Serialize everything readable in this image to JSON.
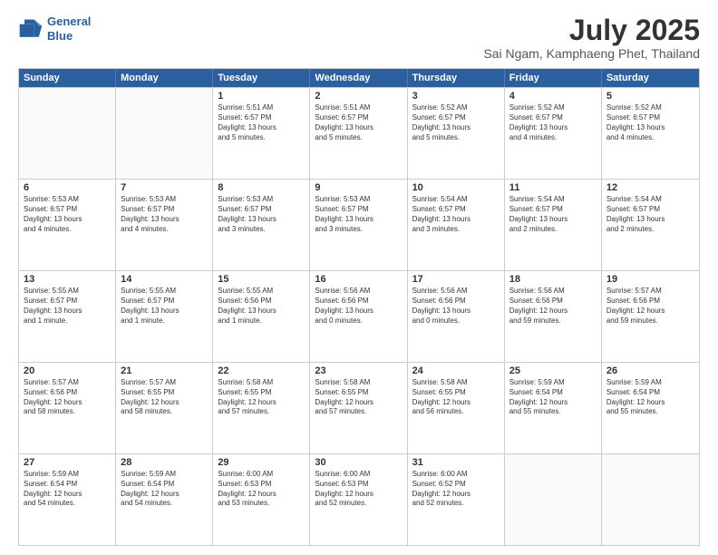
{
  "logo": {
    "line1": "General",
    "line2": "Blue"
  },
  "title": "July 2025",
  "subtitle": "Sai Ngam, Kamphaeng Phet, Thailand",
  "header_days": [
    "Sunday",
    "Monday",
    "Tuesday",
    "Wednesday",
    "Thursday",
    "Friday",
    "Saturday"
  ],
  "weeks": [
    [
      {
        "day": "",
        "empty": true,
        "lines": []
      },
      {
        "day": "",
        "empty": true,
        "lines": []
      },
      {
        "day": "1",
        "empty": false,
        "lines": [
          "Sunrise: 5:51 AM",
          "Sunset: 6:57 PM",
          "Daylight: 13 hours",
          "and 5 minutes."
        ]
      },
      {
        "day": "2",
        "empty": false,
        "lines": [
          "Sunrise: 5:51 AM",
          "Sunset: 6:57 PM",
          "Daylight: 13 hours",
          "and 5 minutes."
        ]
      },
      {
        "day": "3",
        "empty": false,
        "lines": [
          "Sunrise: 5:52 AM",
          "Sunset: 6:57 PM",
          "Daylight: 13 hours",
          "and 5 minutes."
        ]
      },
      {
        "day": "4",
        "empty": false,
        "lines": [
          "Sunrise: 5:52 AM",
          "Sunset: 6:57 PM",
          "Daylight: 13 hours",
          "and 4 minutes."
        ]
      },
      {
        "day": "5",
        "empty": false,
        "lines": [
          "Sunrise: 5:52 AM",
          "Sunset: 6:57 PM",
          "Daylight: 13 hours",
          "and 4 minutes."
        ]
      }
    ],
    [
      {
        "day": "6",
        "empty": false,
        "lines": [
          "Sunrise: 5:53 AM",
          "Sunset: 6:57 PM",
          "Daylight: 13 hours",
          "and 4 minutes."
        ]
      },
      {
        "day": "7",
        "empty": false,
        "lines": [
          "Sunrise: 5:53 AM",
          "Sunset: 6:57 PM",
          "Daylight: 13 hours",
          "and 4 minutes."
        ]
      },
      {
        "day": "8",
        "empty": false,
        "lines": [
          "Sunrise: 5:53 AM",
          "Sunset: 6:57 PM",
          "Daylight: 13 hours",
          "and 3 minutes."
        ]
      },
      {
        "day": "9",
        "empty": false,
        "lines": [
          "Sunrise: 5:53 AM",
          "Sunset: 6:57 PM",
          "Daylight: 13 hours",
          "and 3 minutes."
        ]
      },
      {
        "day": "10",
        "empty": false,
        "lines": [
          "Sunrise: 5:54 AM",
          "Sunset: 6:57 PM",
          "Daylight: 13 hours",
          "and 3 minutes."
        ]
      },
      {
        "day": "11",
        "empty": false,
        "lines": [
          "Sunrise: 5:54 AM",
          "Sunset: 6:57 PM",
          "Daylight: 13 hours",
          "and 2 minutes."
        ]
      },
      {
        "day": "12",
        "empty": false,
        "lines": [
          "Sunrise: 5:54 AM",
          "Sunset: 6:57 PM",
          "Daylight: 13 hours",
          "and 2 minutes."
        ]
      }
    ],
    [
      {
        "day": "13",
        "empty": false,
        "lines": [
          "Sunrise: 5:55 AM",
          "Sunset: 6:57 PM",
          "Daylight: 13 hours",
          "and 1 minute."
        ]
      },
      {
        "day": "14",
        "empty": false,
        "lines": [
          "Sunrise: 5:55 AM",
          "Sunset: 6:57 PM",
          "Daylight: 13 hours",
          "and 1 minute."
        ]
      },
      {
        "day": "15",
        "empty": false,
        "lines": [
          "Sunrise: 5:55 AM",
          "Sunset: 6:56 PM",
          "Daylight: 13 hours",
          "and 1 minute."
        ]
      },
      {
        "day": "16",
        "empty": false,
        "lines": [
          "Sunrise: 5:56 AM",
          "Sunset: 6:56 PM",
          "Daylight: 13 hours",
          "and 0 minutes."
        ]
      },
      {
        "day": "17",
        "empty": false,
        "lines": [
          "Sunrise: 5:56 AM",
          "Sunset: 6:56 PM",
          "Daylight: 13 hours",
          "and 0 minutes."
        ]
      },
      {
        "day": "18",
        "empty": false,
        "lines": [
          "Sunrise: 5:56 AM",
          "Sunset: 6:56 PM",
          "Daylight: 12 hours",
          "and 59 minutes."
        ]
      },
      {
        "day": "19",
        "empty": false,
        "lines": [
          "Sunrise: 5:57 AM",
          "Sunset: 6:56 PM",
          "Daylight: 12 hours",
          "and 59 minutes."
        ]
      }
    ],
    [
      {
        "day": "20",
        "empty": false,
        "lines": [
          "Sunrise: 5:57 AM",
          "Sunset: 6:56 PM",
          "Daylight: 12 hours",
          "and 58 minutes."
        ]
      },
      {
        "day": "21",
        "empty": false,
        "lines": [
          "Sunrise: 5:57 AM",
          "Sunset: 6:55 PM",
          "Daylight: 12 hours",
          "and 58 minutes."
        ]
      },
      {
        "day": "22",
        "empty": false,
        "lines": [
          "Sunrise: 5:58 AM",
          "Sunset: 6:55 PM",
          "Daylight: 12 hours",
          "and 57 minutes."
        ]
      },
      {
        "day": "23",
        "empty": false,
        "lines": [
          "Sunrise: 5:58 AM",
          "Sunset: 6:55 PM",
          "Daylight: 12 hours",
          "and 57 minutes."
        ]
      },
      {
        "day": "24",
        "empty": false,
        "lines": [
          "Sunrise: 5:58 AM",
          "Sunset: 6:55 PM",
          "Daylight: 12 hours",
          "and 56 minutes."
        ]
      },
      {
        "day": "25",
        "empty": false,
        "lines": [
          "Sunrise: 5:59 AM",
          "Sunset: 6:54 PM",
          "Daylight: 12 hours",
          "and 55 minutes."
        ]
      },
      {
        "day": "26",
        "empty": false,
        "lines": [
          "Sunrise: 5:59 AM",
          "Sunset: 6:54 PM",
          "Daylight: 12 hours",
          "and 55 minutes."
        ]
      }
    ],
    [
      {
        "day": "27",
        "empty": false,
        "lines": [
          "Sunrise: 5:59 AM",
          "Sunset: 6:54 PM",
          "Daylight: 12 hours",
          "and 54 minutes."
        ]
      },
      {
        "day": "28",
        "empty": false,
        "lines": [
          "Sunrise: 5:59 AM",
          "Sunset: 6:54 PM",
          "Daylight: 12 hours",
          "and 54 minutes."
        ]
      },
      {
        "day": "29",
        "empty": false,
        "lines": [
          "Sunrise: 6:00 AM",
          "Sunset: 6:53 PM",
          "Daylight: 12 hours",
          "and 53 minutes."
        ]
      },
      {
        "day": "30",
        "empty": false,
        "lines": [
          "Sunrise: 6:00 AM",
          "Sunset: 6:53 PM",
          "Daylight: 12 hours",
          "and 52 minutes."
        ]
      },
      {
        "day": "31",
        "empty": false,
        "lines": [
          "Sunrise: 6:00 AM",
          "Sunset: 6:52 PM",
          "Daylight: 12 hours",
          "and 52 minutes."
        ]
      },
      {
        "day": "",
        "empty": true,
        "lines": []
      },
      {
        "day": "",
        "empty": true,
        "lines": []
      }
    ]
  ]
}
